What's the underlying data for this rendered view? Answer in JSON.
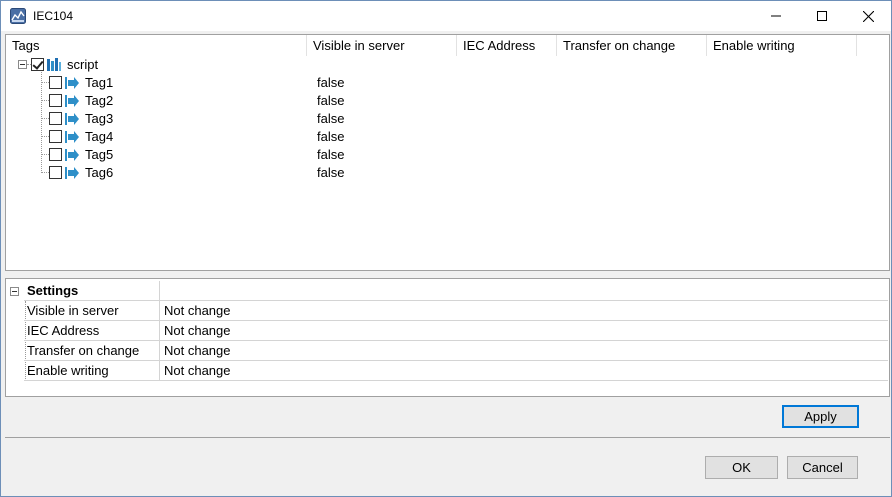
{
  "window": {
    "title": "IEC104",
    "icon": "chart-app-icon"
  },
  "tree": {
    "columns": [
      "Tags",
      "Visible in server",
      "IEC Address",
      "Transfer on change",
      "Enable writing"
    ],
    "root": {
      "label": "script",
      "checked": true,
      "icon": "script-icon"
    },
    "items": [
      {
        "label": "Tag1",
        "visible_in_server": "false",
        "checked": false
      },
      {
        "label": "Tag2",
        "visible_in_server": "false",
        "checked": false
      },
      {
        "label": "Tag3",
        "visible_in_server": "false",
        "checked": false
      },
      {
        "label": "Tag4",
        "visible_in_server": "false",
        "checked": false
      },
      {
        "label": "Tag5",
        "visible_in_server": "false",
        "checked": false
      },
      {
        "label": "Tag6",
        "visible_in_server": "false",
        "checked": false
      }
    ]
  },
  "settings": {
    "category": "Settings",
    "rows": [
      {
        "name": "Visible in server",
        "value": "Not change"
      },
      {
        "name": "IEC Address",
        "value": "Not change"
      },
      {
        "name": "Transfer on change",
        "value": "Not change"
      },
      {
        "name": "Enable writing",
        "value": "Not change"
      }
    ]
  },
  "buttons": {
    "apply": "Apply",
    "ok": "OK",
    "cancel": "Cancel"
  },
  "colors": {
    "accent": "#0078d7",
    "tag_arrow": "#2e8fc8"
  }
}
